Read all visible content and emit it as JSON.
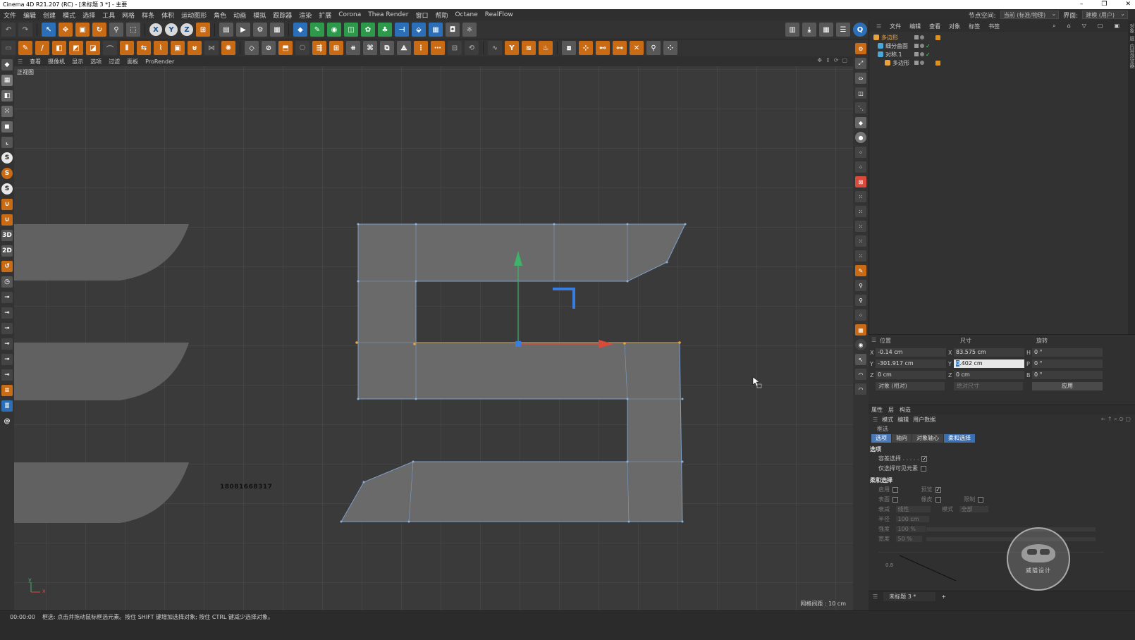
{
  "window": {
    "title": "Cinema 4D R21.207 (RC) - [未标题 3 *] - 主要",
    "controls": [
      "–",
      "❐",
      "✕"
    ]
  },
  "menubar": {
    "items": [
      "文件",
      "编辑",
      "创建",
      "模式",
      "选择",
      "工具",
      "网格",
      "样条",
      "体积",
      "运动图形",
      "角色",
      "动画",
      "模拟",
      "跟踪器",
      "渲染",
      "扩展",
      "Corona",
      "Thea Render",
      "窗口",
      "帮助",
      "Octane",
      "RealFlow"
    ],
    "node_space_label": "节点空间:",
    "node_space_value": "当前 (标准/物理)",
    "interface_label": "界面:",
    "interface_value": "建模 (用户)"
  },
  "viewport": {
    "menu": [
      "查看",
      "摄像机",
      "显示",
      "选项",
      "过滤",
      "面板",
      "ProRender"
    ],
    "label": "正视图",
    "phone_text": "18081668317",
    "grid_spacing": "网格间距 : 10 cm",
    "axis_y": "y",
    "axis_x": "x"
  },
  "object_manager": {
    "tabs": [
      "文件",
      "编辑",
      "查看",
      "对象",
      "标签",
      "书签"
    ],
    "objects": [
      {
        "name": "多边形",
        "indent": 0,
        "color": "#e8a33c",
        "highlight": true
      },
      {
        "name": "细分曲面",
        "indent": 1,
        "color": "#4aa8d8",
        "highlight": false
      },
      {
        "name": "对称.1",
        "indent": 1,
        "color": "#4aa8d8",
        "highlight": false
      },
      {
        "name": "多边形",
        "indent": 2,
        "color": "#e8a33c",
        "highlight": false
      }
    ],
    "side_tabs": [
      "对象",
      "层",
      "内容浏览器"
    ]
  },
  "coordinates": {
    "headers": {
      "position": "位置",
      "size": "尺寸",
      "rotation": "旋转"
    },
    "rows": [
      {
        "axis": "X",
        "pos": "-0.14 cm",
        "size_axis": "X",
        "size": "83.575 cm",
        "rot_axis": "H",
        "rot": "0 °"
      },
      {
        "axis": "Y",
        "pos": "-301.917 cm",
        "size_axis": "Y",
        "size": "0.402 cm",
        "rot_axis": "P",
        "rot": "0 °"
      },
      {
        "axis": "Z",
        "pos": "0 cm",
        "size_axis": "Z",
        "size": "0 cm",
        "rot_axis": "B",
        "rot": "0 °"
      }
    ],
    "mode_dropdown": "对象 (相对)",
    "size_dropdown": "绝对尺寸",
    "apply_label": "应用"
  },
  "attributes": {
    "tabs": [
      "属性",
      "层",
      "构造"
    ],
    "sub": [
      "模式",
      "编辑",
      "用户数据"
    ],
    "tool_title": "框选",
    "buttons": [
      "选项",
      "轴向",
      "对象轴心",
      "柔和选择"
    ],
    "section_options": "选项",
    "opt_tolerant": "容差选择 . . . . .",
    "opt_visible_only": "仅选择可见元素",
    "section_soft": "柔和选择",
    "soft_enable": "启用",
    "soft_preview": "预览",
    "soft_surface": "表面",
    "soft_rubber": "橡皮",
    "soft_restrict": "限制",
    "falloff_label": "衰减",
    "falloff_value": "线性",
    "mode_label": "模式",
    "mode_value": "全部",
    "radius_label": "半径",
    "radius_value": "100 cm",
    "strength_label": "强度",
    "strength_value": "100 %",
    "width_label": "宽度",
    "width_value": "50 %",
    "graph_tick": "0.8"
  },
  "doc_tabs": {
    "current": "未标题 3 *",
    "add": "+"
  },
  "status": {
    "time": "00:00:00",
    "message": "框选: 点击并拖动鼠标框选元素。按住 SHIFT 键增加选择对象; 按住 CTRL 键减少选择对象。"
  },
  "watermark": {
    "text": "威猫设计"
  },
  "colors": {
    "accent_orange": "#c96a14",
    "accent_blue": "#2a6fb8",
    "selection_blue": "#4b79b5"
  }
}
